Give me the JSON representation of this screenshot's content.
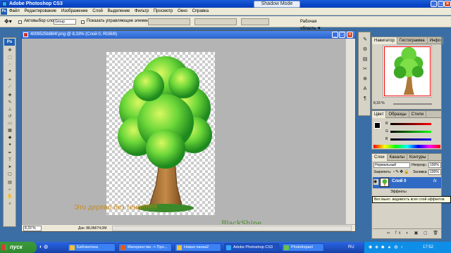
{
  "window": {
    "title": "Adobe Photoshop CS3",
    "shadow_mode": "Shadow Mode"
  },
  "menu": {
    "items": [
      "Файл",
      "Редактирование",
      "Изображение",
      "Слой",
      "Выделение",
      "Фильтр",
      "Просмотр",
      "Окно",
      "Справка"
    ]
  },
  "options_bar": {
    "auto_select_label": "Автовыбор слоя:",
    "auto_select_value": "Group",
    "show_controls_label": "Показать управляющие элементы",
    "workspace_label": "Рабочая область ▼"
  },
  "document": {
    "title": "4009525b884f.png @ 8,33% (Слой 0, RGB/8)",
    "zoom": "8,33 %",
    "doc_size": "Док: 88,0M/74,0M",
    "overlay_text": "Это дерево без тени!!!!!!!!",
    "signature": "BlackShine"
  },
  "panels": {
    "navigator": {
      "tabs": [
        "Навигатор",
        "Гистограмма",
        "Инфо"
      ],
      "zoom": "8,33 %"
    },
    "color": {
      "tabs": [
        "Цвет",
        "Образцы",
        "Стили"
      ],
      "channels": [
        "R",
        "G",
        "B"
      ]
    },
    "layers": {
      "tabs": [
        "Слои",
        "Каналы",
        "Контуры"
      ],
      "blend_mode": "Нормальный",
      "opacity_label": "Непрозр.:",
      "opacity_value": "100%",
      "lock_label": "Закрепить:",
      "fill_label": "Заливка:",
      "fill_value": "100%",
      "layer_name": "Слой 0",
      "effects_label": "Эффекты",
      "tooltip": "Вкл./выкл. видимость всех слой-эффектов"
    }
  },
  "taskbar": {
    "start_label": "пуск",
    "items": [
      "Библиотека",
      "Материнство -> Про...",
      "Новая папка2",
      "Adobe Photoshop CS3",
      "PhotoImpact"
    ],
    "active_index": 3,
    "lang": "RU",
    "clock": "17:52"
  },
  "colors": {
    "titlebar": "#0a46c8",
    "desktop": "#3a6ea5",
    "layer_selected": "#316ac5",
    "overlay_text": "#c98a1a"
  }
}
